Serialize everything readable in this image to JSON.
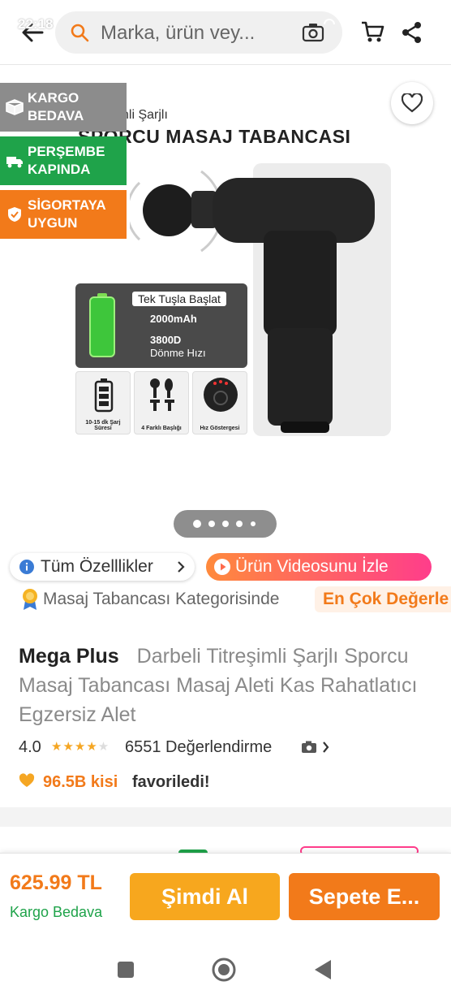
{
  "status_bar": {
    "time": "22:18"
  },
  "header": {
    "search_placeholder": "Marka, ürün vey..."
  },
  "badges": [
    {
      "label": "KARGO BEDAVA",
      "color": "#8c8c8c"
    },
    {
      "label": "PERŞEMBE KAPINDA",
      "color": "#1fa34a"
    },
    {
      "label": "SİGORTAYA UYGUN",
      "color": "#f27a1a"
    }
  ],
  "product_image": {
    "title_line1": "nli Şarjlı",
    "title_line2": "SPORCU MASAJ TABANCASI",
    "feature_pill": "Tek Tuşla Başlat",
    "battery_spec": "2000mAh",
    "speed_spec": "3800D",
    "speed_label": "Dönme Hızı",
    "thumb_captions": [
      "10-15 dk Şarj Süresi",
      "4 Farklı Başlığı",
      "Hız Göstergesi"
    ],
    "pager_count": 5,
    "pager_active": 0
  },
  "features": {
    "specs_label": "Tüm Özelllikler",
    "video_label": "Ürün Videosunu İzle"
  },
  "category": {
    "text": "Masaj Tabancası Kategorisinde",
    "tag": "En Çok Değerle"
  },
  "product": {
    "brand": "Mega Plus",
    "name": "Darbeli Titreşimli Şarjlı Sporcu Masaj Tabancası Masaj Aleti Kas Rahatlatıcı Egzersiz Alet",
    "rating": "4.0",
    "rating_stars": 4,
    "review_count": "6551 Değerlendirme",
    "favorites_count": "96.5B kisi",
    "favorites_text": "favoriledi!"
  },
  "buy_bar": {
    "price": "625.99 TL",
    "shipping": "Kargo Bedava",
    "buy_now": "Şimdi Al",
    "add_to_cart": "Sepete E..."
  },
  "colors": {
    "accent": "#f27a1a",
    "buy_now": "#f7a71e",
    "green": "#1fa34a"
  }
}
